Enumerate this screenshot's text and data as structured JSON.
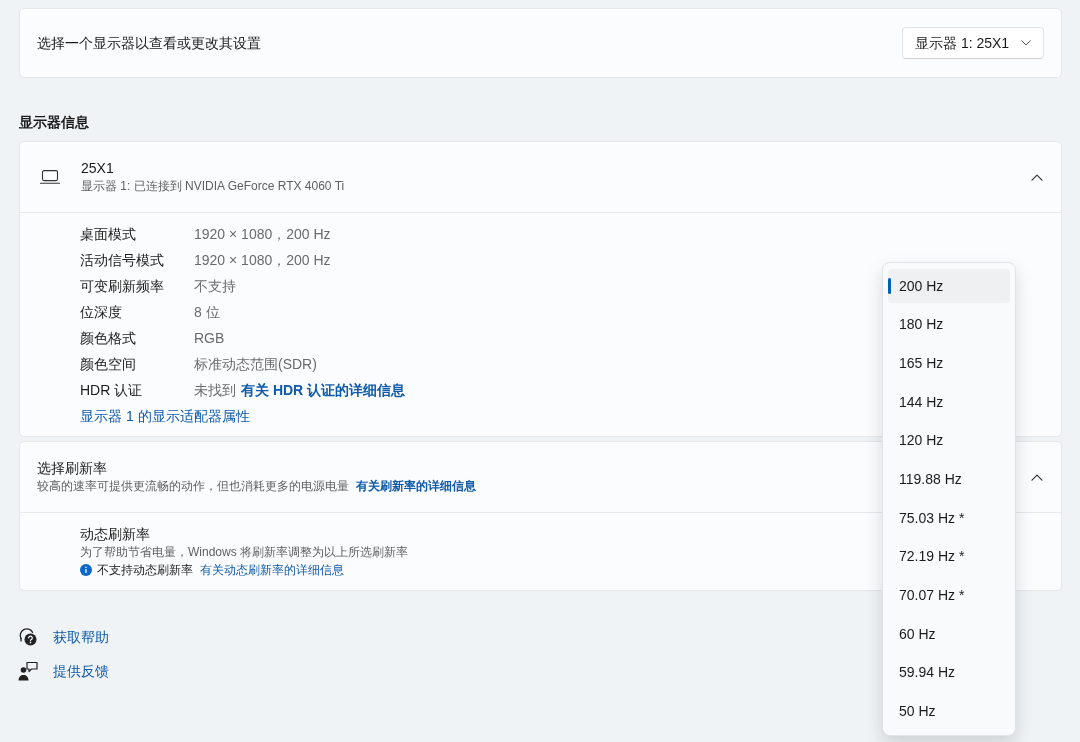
{
  "display_select": {
    "label": "选择一个显示器以查看或更改其设置",
    "dropdown": {
      "value": "显示器 1: 25X1"
    }
  },
  "display_info": {
    "heading": "显示器信息",
    "monitor": {
      "name": "25X1",
      "subtitle": "显示器 1: 已连接到 NVIDIA GeForce RTX 4060 Ti",
      "expanded": true
    },
    "properties": [
      {
        "label": "桌面模式",
        "value": "1920 × 1080，200 Hz"
      },
      {
        "label": "活动信号模式",
        "value": "1920 × 1080，200 Hz"
      },
      {
        "label": "可变刷新频率",
        "value": "不支持"
      },
      {
        "label": "位深度",
        "value": "8 位"
      },
      {
        "label": "颜色格式",
        "value": "RGB"
      },
      {
        "label": "颜色空间",
        "value": "标准动态范围(SDR)"
      },
      {
        "label": "HDR 认证",
        "value": "未找到",
        "link": "有关 HDR 认证的详细信息"
      }
    ],
    "adapter_link": "显示器 1 的显示适配器属性"
  },
  "refresh_rate": {
    "title": "选择刷新率",
    "description": "较高的速率可提供更流畅的动作，但也消耗更多的电源电量",
    "link": "有关刷新率的详细信息",
    "expanded": true,
    "dynamic": {
      "title": "动态刷新率",
      "description": "为了帮助节省电量，Windows 将刷新率调整为以上所选刷新率",
      "notice": "不支持动态刷新率",
      "link": "有关动态刷新率的详细信息"
    },
    "menu": [
      {
        "label": "200 Hz",
        "selected": true
      },
      {
        "label": "180 Hz",
        "selected": false
      },
      {
        "label": "165 Hz",
        "selected": false
      },
      {
        "label": "144 Hz",
        "selected": false
      },
      {
        "label": "120 Hz",
        "selected": false
      },
      {
        "label": "119.88 Hz",
        "selected": false
      },
      {
        "label": "75.03 Hz *",
        "selected": false
      },
      {
        "label": "72.19 Hz *",
        "selected": false
      },
      {
        "label": "70.07 Hz *",
        "selected": false
      },
      {
        "label": "60 Hz",
        "selected": false
      },
      {
        "label": "59.94 Hz",
        "selected": false
      },
      {
        "label": "50 Hz",
        "selected": false
      }
    ]
  },
  "footer_links": [
    {
      "kind": "help",
      "label": "获取帮助"
    },
    {
      "kind": "feedback",
      "label": "提供反馈"
    }
  ]
}
